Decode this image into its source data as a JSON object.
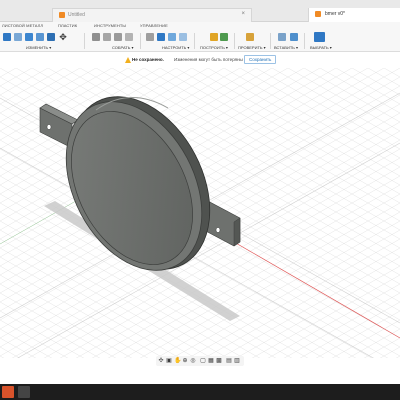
{
  "document_tabs": {
    "left_tab": {
      "label": "Untitled",
      "icon": "document-icon"
    },
    "right_tab": {
      "label": "bmer v0*",
      "icon": "document-icon"
    }
  },
  "ribbon": {
    "tabs": [
      "ЛИСТОВОЙ МЕТАЛЛ",
      "ПЛАСТИК",
      "ИНСТРУМЕНТЫ",
      "УПРАВЛЕНИЕ"
    ],
    "groups": [
      {
        "label": "ИЗМЕНИТЬ ▾"
      },
      {
        "label": "СОБРАТЬ ▾"
      },
      {
        "label": "НАСТРОИТЬ ▾"
      },
      {
        "label": "ПОСТРОИТЬ ▾"
      },
      {
        "label": "ПРОВЕРИТЬ ▾"
      },
      {
        "label": "ВСТАВИТЬ ▾"
      },
      {
        "label": "ВЫБРАТЬ ▾"
      }
    ]
  },
  "notice": {
    "title": "Не сохранено.",
    "message": "Изменения могут быть потеряны",
    "button_label": "Сохранить"
  },
  "colors": {
    "accent": "#1f6fb5",
    "part_face": "#6b6e6b",
    "part_edge": "#3c3e3c",
    "taskbar": "#1d1d1d"
  }
}
